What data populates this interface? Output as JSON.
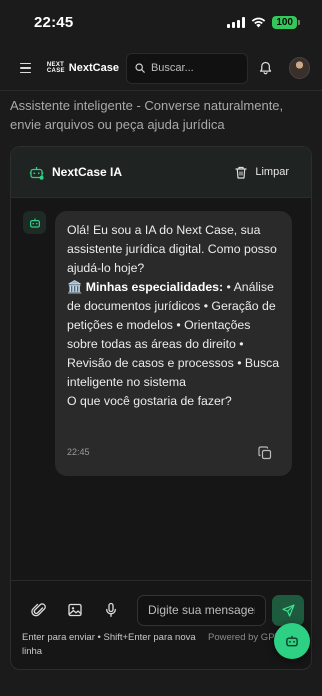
{
  "status": {
    "time": "22:45",
    "battery": "100"
  },
  "header": {
    "logo_line1": "NEXT",
    "logo_line2": "CASE",
    "brand": "NextCase",
    "search_placeholder": "Buscar..."
  },
  "intro": "Assistente inteligente - Converse naturalmente, envie arquivos ou peça ajuda jurídica",
  "chat": {
    "title": "NextCase IA",
    "clear_label": "Limpar",
    "message": {
      "p1": "Olá! Eu sou a IA do Next Case, sua assistente jurídica digital. Como posso ajudá-lo hoje?",
      "specialties_emoji": "🏛️",
      "specialties_title": "Minhas especialidades:",
      "specialties_list": " • Análise de documentos jurídicos • Geração de petições e modelos • Orientações sobre todas as áreas do direito • Revisão de casos e processos • Busca inteligente no sistema",
      "p3": "O que você gostaria de fazer?",
      "time": "22:45"
    },
    "composer": {
      "placeholder": "Digite sua mensagem...",
      "hint": "Enter para enviar • Shift+Enter para nova linha",
      "powered": "Powered by GPT-2.0"
    }
  },
  "colors": {
    "accent": "#2ed183",
    "send": "#1d5a3e",
    "bubble": "#2a2a2a"
  },
  "icons": [
    "menu-icon",
    "search-icon",
    "bell-icon",
    "robot-icon",
    "trash-icon",
    "copy-icon",
    "paperclip-icon",
    "image-icon",
    "microphone-icon",
    "send-icon"
  ]
}
